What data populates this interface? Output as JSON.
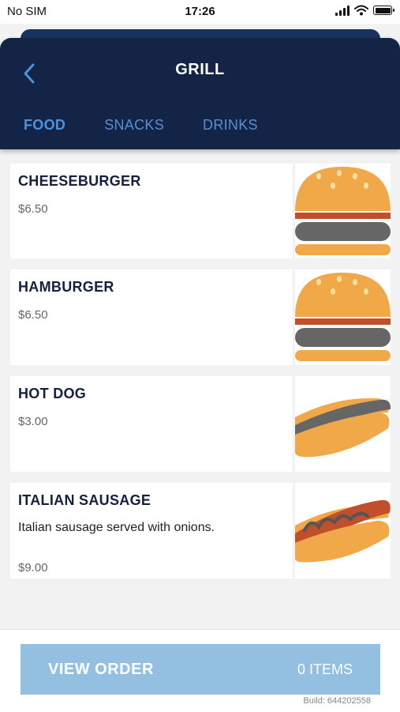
{
  "status_bar": {
    "carrier": "No SIM",
    "time": "17:26"
  },
  "header": {
    "title": "GRILL",
    "back_icon": "chevron-left-icon"
  },
  "tabs": [
    {
      "label": "FOOD",
      "active": true
    },
    {
      "label": "SNACKS",
      "active": false
    },
    {
      "label": "DRINKS",
      "active": false
    }
  ],
  "menu_items": [
    {
      "name": "CHEESEBURGER",
      "description": "",
      "price": "$6.50",
      "icon": "burger-icon"
    },
    {
      "name": "HAMBURGER",
      "description": "",
      "price": "$6.50",
      "icon": "burger-icon"
    },
    {
      "name": "HOT DOG",
      "description": "",
      "price": "$3.00",
      "icon": "hot-dog-icon"
    },
    {
      "name": "ITALIAN SAUSAGE",
      "description": "Italian sausage served with onions.",
      "price": "$9.00",
      "icon": "sausage-icon"
    }
  ],
  "footer": {
    "view_order_label": "VIEW ORDER",
    "item_count": "0 ITEMS",
    "build": "Build: 644202558"
  },
  "colors": {
    "header_bg": "#132447",
    "tab_active": "#4b93e0",
    "button_bg": "#93c0e1",
    "title_text": "#13213f"
  }
}
